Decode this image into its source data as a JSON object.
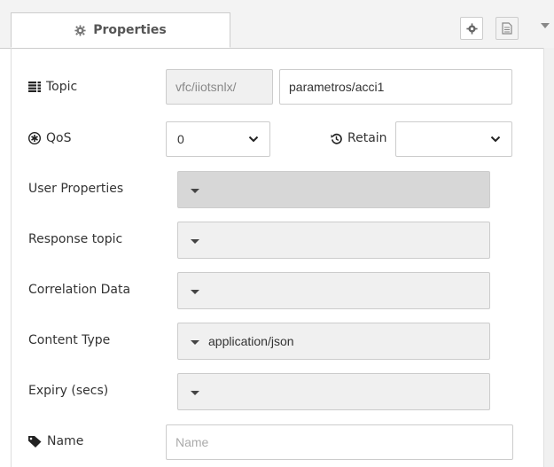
{
  "tab": {
    "label": "Properties",
    "icon": "gear-icon"
  },
  "toolbar": {
    "settings_icon": "gear-icon",
    "description_icon": "document-icon",
    "menu_icon": "caret-down-icon"
  },
  "form": {
    "topic": {
      "label": "Topic",
      "icon": "tasks-icon",
      "prefix": "vfc/iiotsnlx/",
      "value": "parametros/acci1"
    },
    "qos": {
      "label": "QoS",
      "icon": "asterisk-circle-icon",
      "value": "0"
    },
    "retain": {
      "label": "Retain",
      "icon": "history-icon",
      "value": ""
    },
    "user_properties": {
      "label": "User Properties",
      "value": ""
    },
    "response_topic": {
      "label": "Response topic",
      "value": ""
    },
    "correlation_data": {
      "label": "Correlation Data",
      "value": ""
    },
    "content_type": {
      "label": "Content Type",
      "value": "application/json"
    },
    "expiry": {
      "label": "Expiry (secs)",
      "value": ""
    },
    "name": {
      "label": "Name",
      "icon": "tag-icon",
      "placeholder": "Name",
      "value": ""
    }
  },
  "colors": {
    "border": "#cccccc",
    "field_disabled_bg": "#f0f0f0",
    "field_active_bg": "#d7d7d7",
    "text": "#333333",
    "muted": "#888888"
  }
}
